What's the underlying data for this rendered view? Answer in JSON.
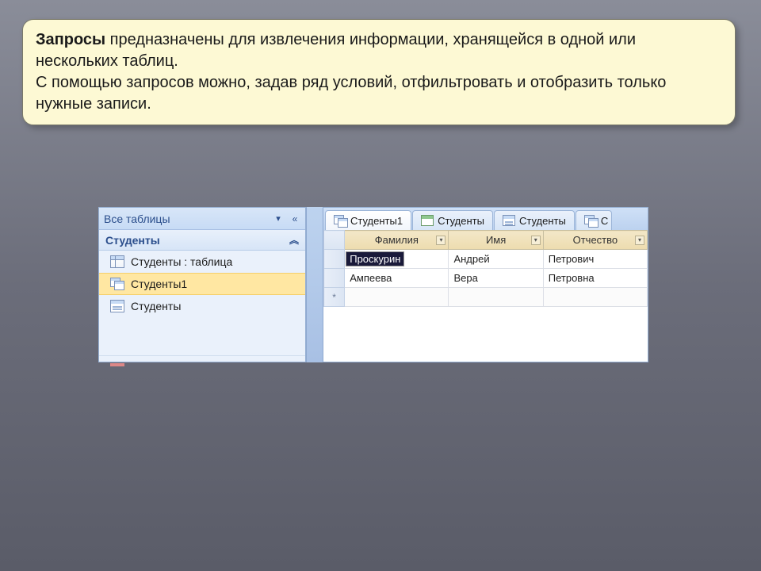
{
  "info": {
    "bold": "Запросы",
    "text1": " предназначены для извлечения информации, хранящейся в одной или нескольких таблиц.",
    "text2": "С помощью запросов можно, задав ряд условий, отфильтровать и отобразить только нужные записи."
  },
  "navpane": {
    "header": "Все таблицы",
    "group": "Студенты",
    "items": [
      {
        "label": "Студенты : таблица",
        "icon": "table"
      },
      {
        "label": "Студенты1",
        "icon": "query"
      },
      {
        "label": "Студенты",
        "icon": "form"
      }
    ]
  },
  "tabs": [
    {
      "label": "Студенты1",
      "icon": "query",
      "active": true
    },
    {
      "label": "Студенты",
      "icon": "green"
    },
    {
      "label": "Студенты",
      "icon": "form"
    },
    {
      "label": "С",
      "icon": "query",
      "cut": true
    }
  ],
  "grid": {
    "columns": [
      "Фамилия",
      "Имя",
      "Отчество"
    ],
    "rows": [
      {
        "f": "Проскурин",
        "i": "Андрей",
        "o": "Петрович",
        "selected": true
      },
      {
        "f": "Ампеева",
        "i": "Вера",
        "o": "Петровна"
      }
    ],
    "newrow_marker": "*"
  }
}
